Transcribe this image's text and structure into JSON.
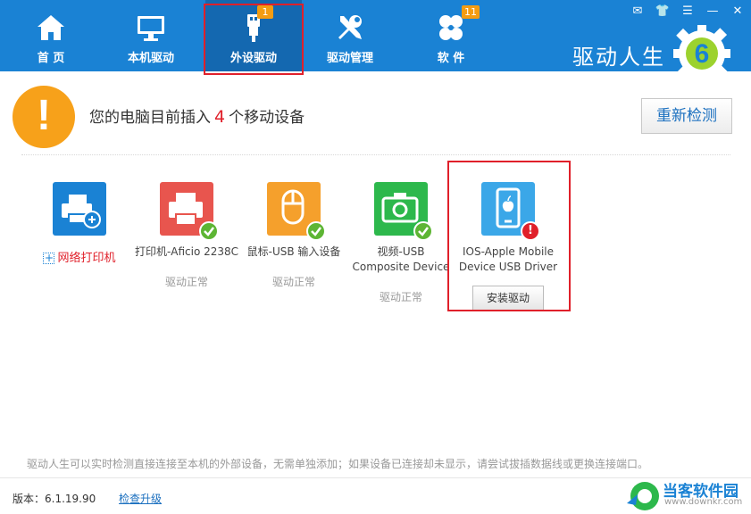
{
  "nav": {
    "items": [
      {
        "label": "首 页",
        "icon": "home-icon"
      },
      {
        "label": "本机驱动",
        "icon": "monitor-icon"
      },
      {
        "label": "外设驱动",
        "icon": "usb-icon",
        "badge": "1",
        "active": true
      },
      {
        "label": "驱动管理",
        "icon": "tools-icon"
      },
      {
        "label": "软 件",
        "icon": "flower-icon",
        "badge": "11"
      }
    ]
  },
  "window_controls": [
    "message-icon",
    "shirt-icon",
    "menu-icon",
    "minimize-icon",
    "close-icon"
  ],
  "brand": {
    "text": "驱动人生",
    "logo_digit": "6"
  },
  "alert": {
    "prefix": "您的电脑目前插入",
    "count": "4",
    "suffix": "个移动设备",
    "rescan_label": "重新检测"
  },
  "devices": [
    {
      "name": "打印机-Aficio 2238C",
      "status": "驱动正常",
      "icon": "printer-icon",
      "color": "#e8554e"
    },
    {
      "name": "鼠标-USB 输入设备",
      "status": "驱动正常",
      "icon": "mouse-icon",
      "color": "#f5a02c"
    },
    {
      "name": "视频-USB Composite Device",
      "status": "驱动正常",
      "icon": "camera-icon",
      "color": "#2db84c"
    },
    {
      "name": "IOS-Apple Mobile Device USB Driver",
      "action": "安装驱动",
      "icon": "phone-icon",
      "color": "#3ba7e8"
    }
  ],
  "network_printer": {
    "label": "网络打印机",
    "color": "#1a82d4"
  },
  "hint": "驱动人生可以实时检测直接连接至本机的外部设备，无需单独添加；如果设备已连接却未显示，请尝试拔插数据线或更换连接端口。",
  "footer": {
    "version": "版本：6.1.19.90",
    "upgrade_label": "检查升级",
    "watermark": "当客软件园",
    "watermark_sub": "www.downkr.com"
  },
  "colors": {
    "header": "#1a82d4",
    "accent_red": "#e0202a",
    "alert_orange": "#f7a11a"
  }
}
